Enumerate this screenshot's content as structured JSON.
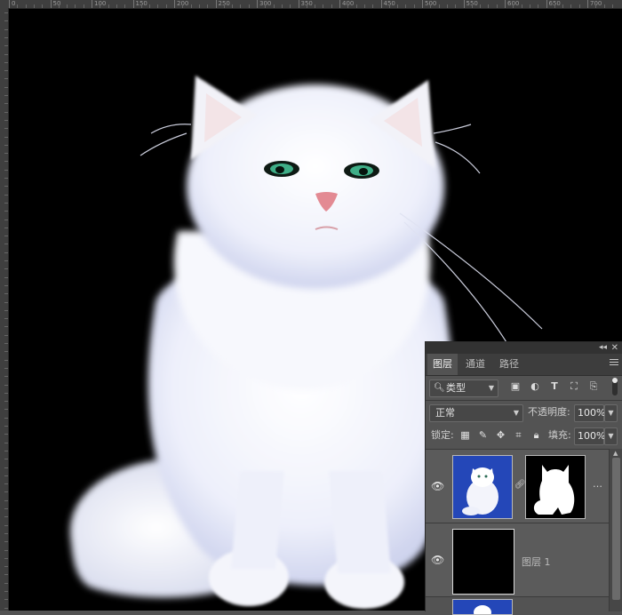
{
  "ruler": {
    "ticks": [
      "0",
      "50",
      "100",
      "150",
      "200",
      "250",
      "300",
      "350",
      "400",
      "450",
      "500",
      "550",
      "600",
      "650",
      "700"
    ]
  },
  "canvas": {
    "background": "#000000",
    "subject": "white Persian cat"
  },
  "annotations": {
    "arrow_color": "#e23b2e"
  },
  "panel": {
    "tabs": [
      {
        "label": "图层",
        "active": true
      },
      {
        "label": "通道",
        "active": false
      },
      {
        "label": "路径",
        "active": false
      }
    ],
    "filter": {
      "label": "类型"
    },
    "filter_icons": [
      "image-filter-icon",
      "adjustment-filter-icon",
      "type-filter-icon",
      "shape-filter-icon",
      "smart-object-filter-icon"
    ],
    "blend_mode": "正常",
    "opacity_label": "不透明度:",
    "opacity_value": "100%",
    "lock_label": "锁定:",
    "lock_icons": [
      "lock-transparent-icon",
      "lock-paint-icon",
      "lock-position-icon",
      "lock-artboard-icon",
      "lock-all-icon"
    ],
    "fill_label": "填充:",
    "fill_value": "100%",
    "layers": [
      {
        "name": "",
        "has_mask": true,
        "visible": true
      },
      {
        "name": "图层 1",
        "has_mask": false,
        "visible": true
      },
      {
        "name": "",
        "has_mask": false,
        "visible": true
      }
    ]
  }
}
